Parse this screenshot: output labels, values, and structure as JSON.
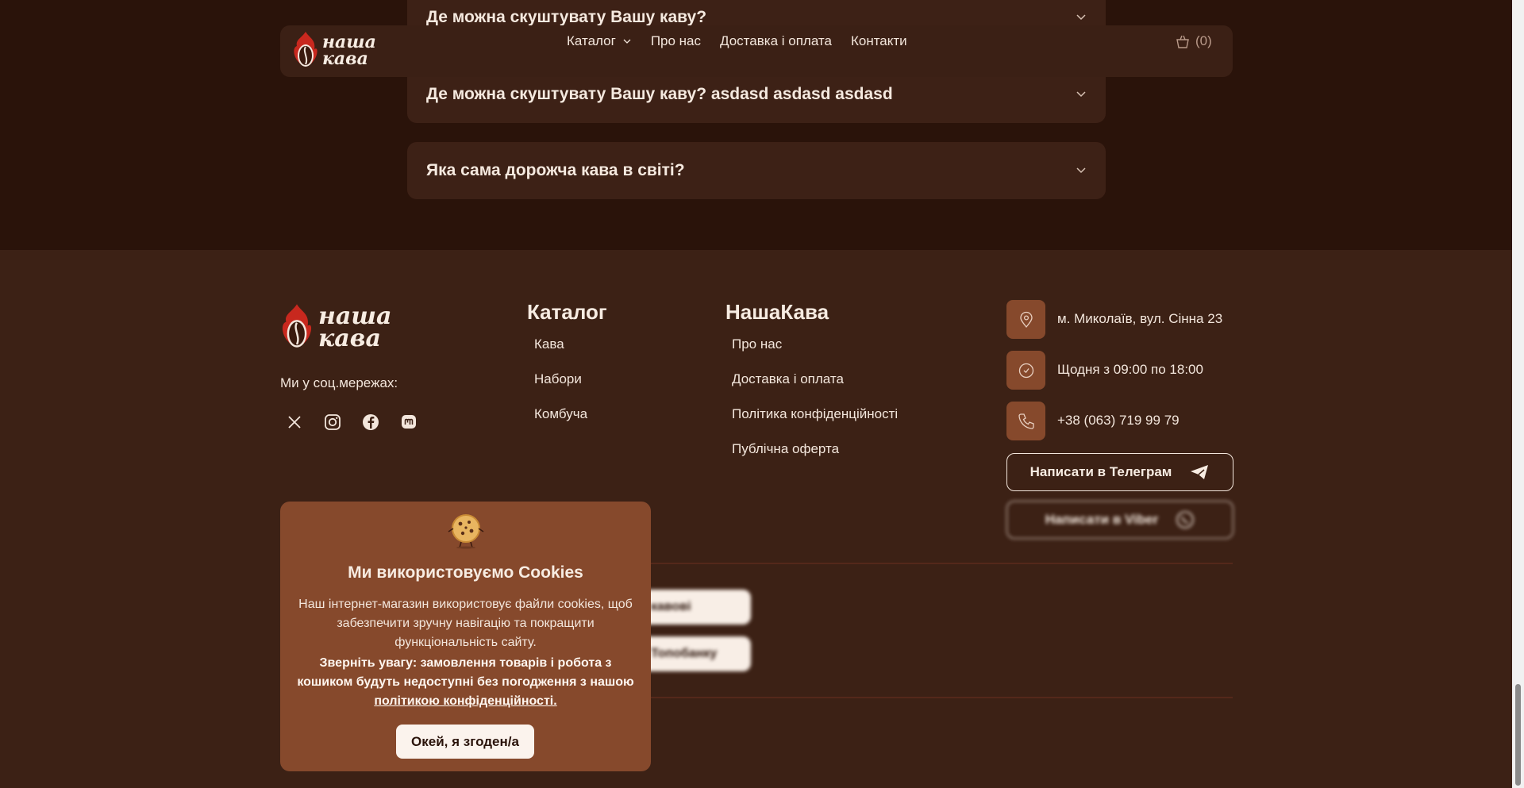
{
  "faq": [
    {
      "question": "Де можна скуштувату Вашу каву?"
    },
    {
      "question": "Де можна скуштувату Вашу каву? asdasd asdasd asdasd"
    },
    {
      "question": "Яка сама дорожча кава в світі?"
    }
  ],
  "header": {
    "logo_line1": "наша",
    "logo_line2": "кава",
    "nav": [
      {
        "label": "Каталог"
      },
      {
        "label": "Про нас"
      },
      {
        "label": "Доставка і оплата"
      },
      {
        "label": "Контакти"
      }
    ],
    "cart_count": "(0)"
  },
  "footer": {
    "logo_line1": "наша",
    "logo_line2": "кава",
    "social_label": "Ми у соц.мережах:",
    "social_icons": [
      "x-icon",
      "instagram-icon",
      "facebook-icon",
      "mastodon-icon"
    ],
    "catalog": {
      "title": "Каталог",
      "links": [
        "Кава",
        "Набори",
        "Комбуча"
      ]
    },
    "company": {
      "title": "НашаКава",
      "links": [
        "Про нас",
        "Доставка і оплата",
        "Політика конфіденційності",
        "Публічна оферта"
      ]
    },
    "contacts": {
      "address": "м. Миколаїв, вул. Сінна 23",
      "hours": "Щодня з 09:00 по 18:00",
      "phone": "+38 (063) 719 99 79",
      "telegram_button": "Написати в Телеграм",
      "viber_button": "Написати в Viber"
    },
    "pills": [
      "кавові",
      "Топобанку"
    ]
  },
  "cookie": {
    "title": "Ми використовуємо Cookies",
    "body": "Наш інтернет-магазин використовує файли cookies, щоб забезпечити зручну навігацію та покращити функціональність сайту.",
    "warning": "Зверніть увагу: замовлення товарів і робота з кошиком будуть недоступні без погодження з нашою",
    "link": "політикою конфіденційності.",
    "accept_button": "Окей, я згоден/а"
  },
  "colors": {
    "bg_dark": "#2a130a",
    "footer_bg": "#3c2115",
    "accent": "#86492c",
    "text": "#f3e6dc"
  }
}
